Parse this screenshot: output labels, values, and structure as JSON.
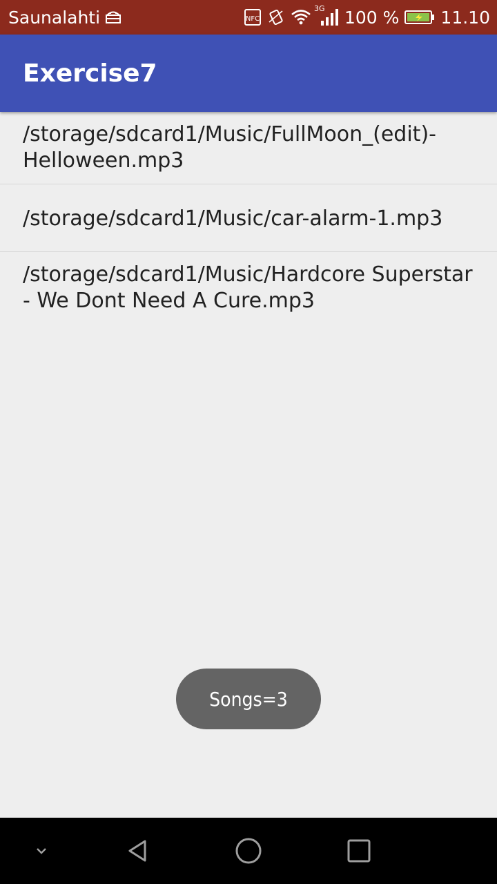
{
  "status_bar": {
    "carrier": "Saunalahti",
    "battery_percent": "100 %",
    "time": "11.10",
    "network_type": "3G",
    "icons": [
      "android-debug-icon",
      "nfc-icon",
      "vibrate-icon",
      "wifi-icon",
      "cell-signal-icon",
      "battery-charging-icon"
    ]
  },
  "app_bar": {
    "title": "Exercise7"
  },
  "songs": [
    {
      "path": "/storage/sdcard1/Music/FullMoon_(edit)-Helloween.mp3"
    },
    {
      "path": "/storage/sdcard1/Music/car-alarm-1.mp3"
    },
    {
      "path": "/storage/sdcard1/Music/Hardcore Superstar - We Dont Need A Cure.mp3"
    }
  ],
  "toast": {
    "text": "Songs=3"
  },
  "nav_bar": {
    "icons": [
      "collapse-chevron-icon",
      "back-icon",
      "home-icon",
      "recents-icon"
    ]
  },
  "colors": {
    "status_bar": "#8c2a1d",
    "app_bar": "#3f51b5",
    "background": "#eeeeee",
    "toast": "#646464"
  }
}
